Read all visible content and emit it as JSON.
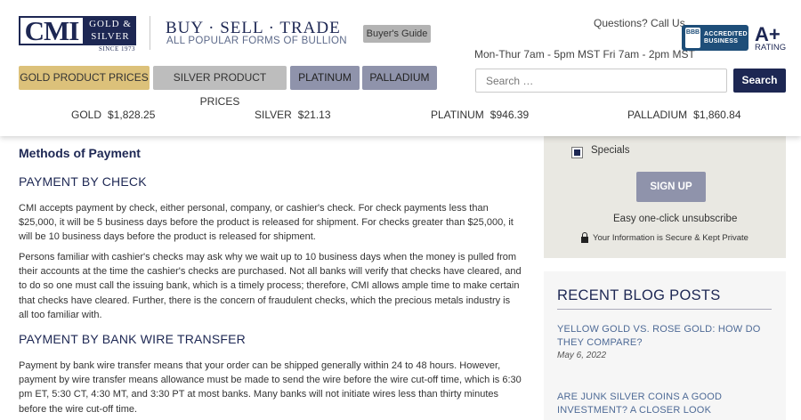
{
  "header": {
    "logo": {
      "main": "CMI",
      "line1": "GOLD &",
      "line2": "SILVER",
      "since": "SINCE 1973"
    },
    "tagline": {
      "main": "BUY · SELL · TRADE",
      "sub": "ALL POPULAR FORMS OF BULLION"
    },
    "buyers_guide": "Buyer's Guide",
    "questions": "Questions? Call Us",
    "hours": "Mon-Thur 7am - 5pm MST Fri 7am - 2pm MST",
    "bbb": {
      "badge": "BBB",
      "line1": "ACCREDITED",
      "line2": "BUSINESS",
      "grade": "A+",
      "rating_label": "RATING"
    },
    "nav": {
      "gold": "GOLD PRODUCT PRICES",
      "silver": "SILVER PRODUCT PRICES",
      "platinum": "PLATINUM",
      "palladium": "PALLADIUM"
    },
    "search": {
      "placeholder": "Search …",
      "button": "Search"
    },
    "ticker": [
      {
        "metal": "GOLD",
        "price": "$1,828.25"
      },
      {
        "metal": "SILVER",
        "price": "$21.13"
      },
      {
        "metal": "PLATINUM",
        "price": "$946.39"
      },
      {
        "metal": "PALLADIUM",
        "price": "$1,860.84"
      }
    ]
  },
  "main": {
    "title": "Methods of Payment",
    "sections": [
      {
        "heading": "PAYMENT BY CHECK",
        "paragraphs": [
          "CMI accepts payment by check, either personal, company, or cashier's check. For check payments less than $25,000, it will be 5 business days before the product is released for shipment. For checks greater than $25,000, it will be 10 business days before the product is released for shipment.",
          "Persons familiar with cashier's checks may ask why we wait up to 10 business days when the money is pulled from their accounts at the time the cashier's checks are purchased. Not all banks will verify that checks have cleared, and to do so one must call the issuing bank, which is a timely process; therefore, CMI allows ample time to make certain that checks have cleared. Further, there is the concern of fraudulent checks, which the precious metals industry is all too familiar with."
        ]
      },
      {
        "heading": "PAYMENT BY BANK WIRE TRANSFER",
        "paragraphs": [
          "Payment by bank wire transfer means that your order can be shipped generally within 24 to 48 hours. However, payment by wire transfer means allowance must be made to send the wire before the wire cut-off time, which is 6:30 pm ET, 5:30 CT, 4:30 MT, and 3:30 PT at most banks. Many banks will not initiate wires less than thirty minutes before the wire cut-off time."
        ]
      }
    ]
  },
  "sidebar": {
    "signup": {
      "specials_label": "Specials",
      "specials_checked": true,
      "button": "SIGN UP",
      "unsubscribe": "Easy one-click unsubscribe",
      "secure": "Your Information is Secure & Kept Private"
    },
    "blog": {
      "title": "RECENT BLOG POSTS",
      "posts": [
        {
          "title": "YELLOW GOLD VS. ROSE GOLD: HOW DO THEY COMPARE?",
          "date": "May 6, 2022"
        },
        {
          "title": "ARE JUNK SILVER COINS A GOOD INVESTMENT? A CLOSER LOOK",
          "date": ""
        }
      ]
    }
  },
  "colors": {
    "navy": "#1d2753",
    "gold": "#dcc17a",
    "silver": "#bdbdbd",
    "platinum": "#8f93ab",
    "link": "#4e6a96"
  }
}
